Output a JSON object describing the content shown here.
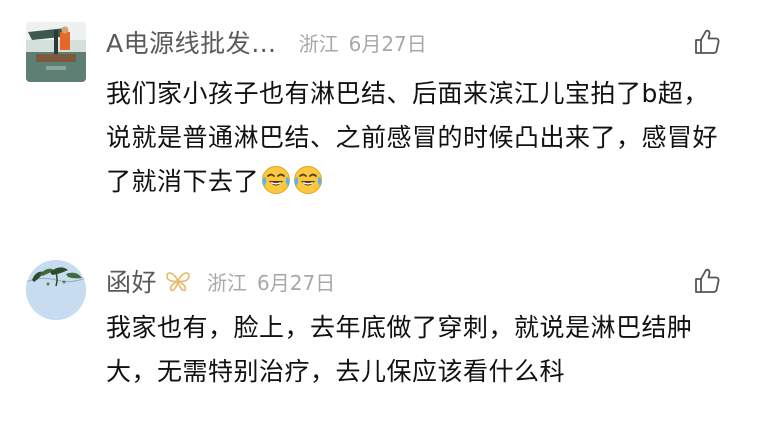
{
  "comments": [
    {
      "username": "A电源线批发…",
      "location": "浙江",
      "date": "6月27日",
      "text": "我们家小孩子也有淋巴结、后面来滨江儿宝拍了b超，说就是普通淋巴结、之前感冒的时候凸出来了，感冒好了就消下去了",
      "emojis": [
        "face-with-tears-of-joy",
        "face-with-tears-of-joy"
      ],
      "avatar": "boat-photo-avatar",
      "like_icon": "thumbs-up-icon"
    },
    {
      "username": "函好",
      "badge": "butterfly-badge-icon",
      "location": "浙江",
      "date": "6月27日",
      "text": "我家也有，脸上，去年底做了穿刺，就说是淋巴结肿大，无需特别治疗，去儿保应该看什么科",
      "avatar": "plant-sky-avatar",
      "like_icon": "thumbs-up-icon"
    }
  ],
  "colors": {
    "username": "#5a5a5a",
    "meta": "#a8a8a8",
    "text": "#111111",
    "badge": "#e8b86a",
    "background": "#ffffff"
  }
}
